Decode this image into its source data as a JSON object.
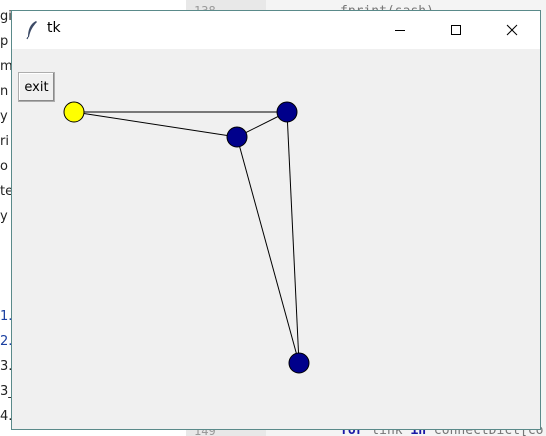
{
  "window": {
    "title": "tk"
  },
  "client": {
    "exit_label": "exit"
  },
  "graph": {
    "nodes": [
      {
        "id": "n0",
        "color": "#ffff00"
      },
      {
        "id": "n1",
        "color": "#00008b"
      },
      {
        "id": "n2",
        "color": "#00008b"
      },
      {
        "id": "n3",
        "color": "#00008b"
      }
    ],
    "edges": [
      [
        "n0",
        "n1"
      ],
      [
        "n0",
        "n2"
      ],
      [
        "n1",
        "n2"
      ],
      [
        "n1",
        "n3"
      ],
      [
        "n2",
        "n3"
      ]
    ]
  },
  "background": {
    "left_fragments": [
      "gi",
      "p",
      "m",
      "n",
      "y",
      "ri",
      "o",
      "te",
      "y",
      "1.",
      "2.",
      "3.",
      "3_",
      "4."
    ],
    "editor_line_numbers": [
      "138",
      "149"
    ],
    "editor_code_top": "fprint(sash)",
    "editor_code_bottom_kw1": "for",
    "editor_code_bottom_mid": " link ",
    "editor_code_bottom_kw2": "in",
    "editor_code_bottom_rest": " connectDict[co"
  }
}
